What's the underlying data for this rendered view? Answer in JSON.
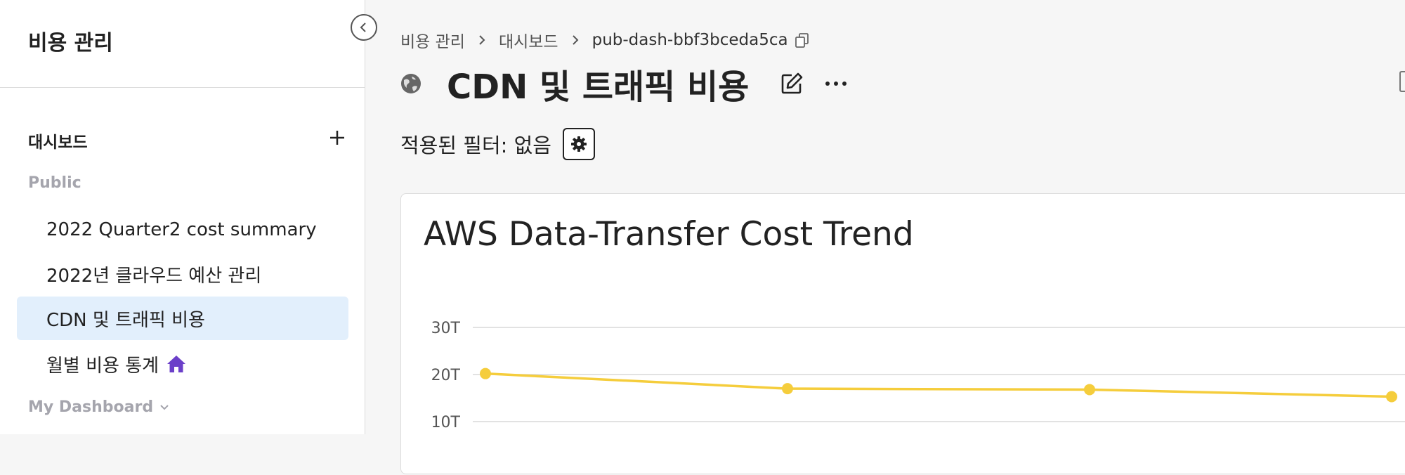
{
  "sidebar": {
    "title": "비용 관리",
    "section_heading": "대시보드",
    "public_label": "Public",
    "public_items": [
      {
        "label": "2022 Quarter2 cost summary",
        "active": false
      },
      {
        "label": "2022년 클라우드 예산 관리",
        "active": false
      },
      {
        "label": "CDN 및 트래픽 비용",
        "active": true
      },
      {
        "label": "월별 비용 통계",
        "active": false,
        "home": true
      }
    ],
    "my_dashboard_label": "My Dashboard"
  },
  "breadcrumb": [
    "비용 관리",
    "대시보드",
    "pub-dash-bbf3bceda5ca"
  ],
  "header": {
    "title": "CDN 및 트래픽 비용"
  },
  "filter": {
    "label": "적용된 필터: 없음"
  },
  "widget": {
    "title": "AWS Data-Transfer Cost Trend"
  },
  "colors": {
    "accent": "#f5cd3c",
    "active_bg": "#e2effc",
    "home_icon": "#6b3fc9"
  },
  "chart_data": {
    "type": "line",
    "title": "AWS Data-Transfer Cost Trend",
    "y_ticks": [
      "30T",
      "20T",
      "10T"
    ],
    "y_tick_values": [
      30,
      20,
      10
    ],
    "x": [
      0,
      1,
      2,
      3
    ],
    "series": [
      {
        "values": [
          20.2,
          17.0,
          16.8,
          15.3
        ]
      }
    ],
    "grid": true
  }
}
